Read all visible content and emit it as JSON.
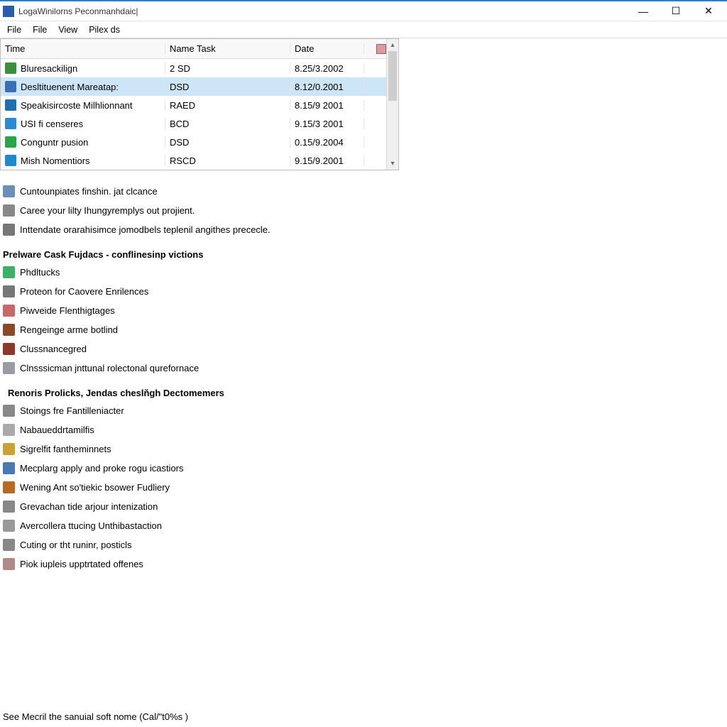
{
  "window": {
    "title": "LogaWinilorns Peconmanhdaic|"
  },
  "menu": {
    "file1": "File",
    "file2": "File",
    "view": "View",
    "pilex": "Pilex ds"
  },
  "table": {
    "headers": {
      "time": "Time",
      "name": "Name Task",
      "date": "Date"
    },
    "rows": [
      {
        "label": "Bluresackilign",
        "task": "2 SD",
        "date": "8.25/3.2002",
        "color": "#3a8f3a"
      },
      {
        "label": "Desltituenent Mareatap:",
        "task": "DSD",
        "date": "8.12/0.2001",
        "color": "#3a6fb5",
        "selected": true
      },
      {
        "label": "Speakisircoste Milhlionnant",
        "task": "RAED",
        "date": "8.15/9 2001",
        "color": "#1f6fb0"
      },
      {
        "label": "USI fi censeres",
        "task": "BCD",
        "date": "9.15/3 2001",
        "color": "#2a8ad6"
      },
      {
        "label": "Conguntr pusion",
        "task": "DSD",
        "date": "0.15/9.2004",
        "color": "#2aa54a"
      },
      {
        "label": "Mish Nomentiors",
        "task": "RSCD",
        "date": "9.15/9.2001",
        "color": "#1f88d0"
      }
    ]
  },
  "tips": [
    {
      "label": "Cuntounpiates finshin. jat clcance",
      "color": "#6a90b8"
    },
    {
      "label": "Caree your lilty Ihungyremplys out projient.",
      "color": "#888"
    },
    {
      "label": "Inttendate orarahisimce jomodbels teplenil angithes prececle.",
      "color": "#777"
    }
  ],
  "section1": {
    "title": "Prelware Cask Fujdacs - conflinesinp victions",
    "items": [
      {
        "label": "Phdltucks",
        "color": "#3fae6a"
      },
      {
        "label": "Proteon for Caovere Enrilences",
        "color": "#777"
      },
      {
        "label": "Piwveide Flenthigtages",
        "color": "#c46a6a"
      },
      {
        "label": "Rengeinge arme botlind",
        "color": "#8a4a2a"
      },
      {
        "label": "Clussnancegred",
        "color": "#8a3a2a"
      },
      {
        "label": "Clnsssicman jnttunal rolectonal qurefornace",
        "color": "#9a9aa5"
      }
    ]
  },
  "section2": {
    "title": "Renoris Prolicks, Jendas cheslňgh Dectomemers",
    "icon_color": "#b03a4a",
    "items": [
      {
        "label": "Stoings fre Fantilleniacter",
        "color": "#888"
      },
      {
        "label": "Nabaueddrtamilfis",
        "color": "#aaa"
      },
      {
        "label": "Sigrelfit fantheminnets",
        "color": "#caa13a"
      },
      {
        "label": "Mecplarg apply and proke rogu icastiors",
        "color": "#4a78b0"
      },
      {
        "label": "Wening Ant so'tiekic bsower Fudliery",
        "color": "#b56a2a"
      },
      {
        "label": "Grevachan tide arjour intenization",
        "color": "#888"
      },
      {
        "label": "Avercollera ttucing Unthibastaction",
        "color": "#999"
      },
      {
        "label": "Cuting or tht runinr, posticls",
        "color": "#888"
      },
      {
        "label": "Piok iupleis upptrtated offenes",
        "color": "#b08a8a"
      }
    ]
  },
  "status": "See Mecril the sanuial soft nome (Cal/\"t0%s )"
}
